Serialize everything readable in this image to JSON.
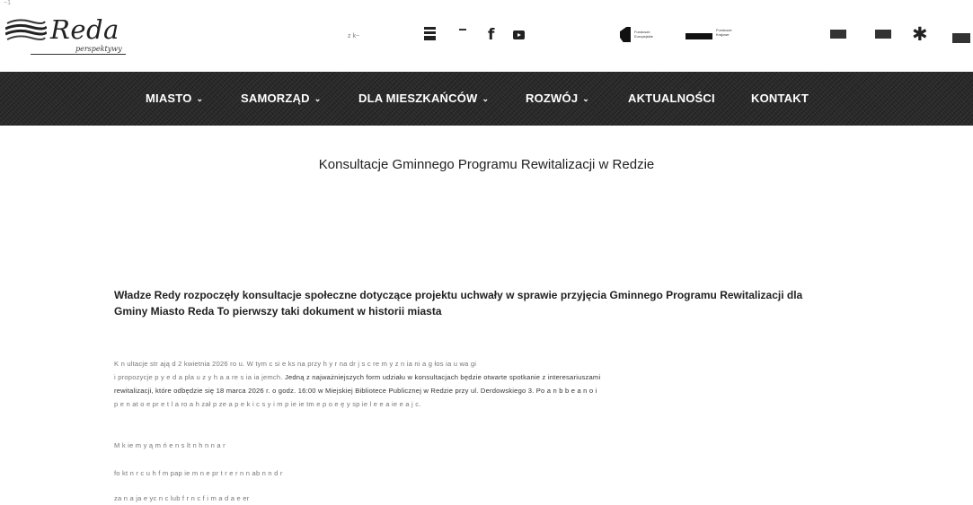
{
  "header": {
    "corner_mark": "~1",
    "logo": {
      "name": "Reda",
      "tagline": "perspektywy"
    },
    "search_label": "z k~",
    "funds": {
      "fund1": "Fundusze\nEuropejskie",
      "fund2": "Fundusze\nKrajowe"
    }
  },
  "nav": {
    "items": [
      {
        "label": "MIASTO",
        "dropdown": true
      },
      {
        "label": "SAMORZĄD",
        "dropdown": true
      },
      {
        "label": "DLA MIESZKAŃCÓW",
        "dropdown": true
      },
      {
        "label": "ROZWÓJ",
        "dropdown": true
      },
      {
        "label": "AKTUALNOŚCI",
        "dropdown": false
      },
      {
        "label": "KONTAKT",
        "dropdown": false
      }
    ],
    "chevron": "⌄"
  },
  "article": {
    "title": "Konsultacje Gminnego Programu Rewitalizacji w Redzie",
    "lead": "Władze Redy rozpoczęły konsultacje społeczne dotyczące projektu uchwały w sprawie przyjęcia Gminnego Programu Rewitalizacji dla Gminy Miasto Reda  To pierwszy taki dokument w historii miasta",
    "paragraph1": {
      "line1": "K n ultacje str ają d 2 kwietnia 2026 ro u. W tym c si e ks  na przy   h y r na     dr  j  s  c  re  m    y  z    n  ia  ni   a g  łos  ia      u    wa gi",
      "line2a": "i   propozycje p  y  e d     a  pla  u  z  y  h  a a re  s  ia   ia  jemch.",
      "line2b": " Jedną z najważniejszych form udziału w konsultacjach będzie otwarte spotkanie z interesariuszami",
      "line3": "rewitalizacji, które odbędzie się 18 marca 2026 r. o godz. 16:00 w Miejskiej Bibliotece Publicznej w Redzie przy ul. Derdowskiego 3. Po  a n  b  b e a n   o i",
      "line4": "p   e n  at  o  e  pr  e  t   l   a   ro  a  h  zał   p  ze      a    p  e   k   i     c    s  y   i   m    p   ie  ie  tm   e   p   o   e  ę  y  sp    ie   l   e  e  a   ie  e  a  j   c."
    },
    "paragraph2": "M   k  ie  m   y   ą   m   ń  e   n  s  lt    n  h  n  n    a r",
    "paragraph3": "   fo   kt   n   r   c  u   h   f  m  pap   ie   m    n   e   pr   t   r  e    r    n  n ab   n   n   d    r",
    "paragraph4": "    za   n  a  ja  e  yc   n  c  lub   f  r   n    c   f   i   m   a   d   a   e   er"
  }
}
